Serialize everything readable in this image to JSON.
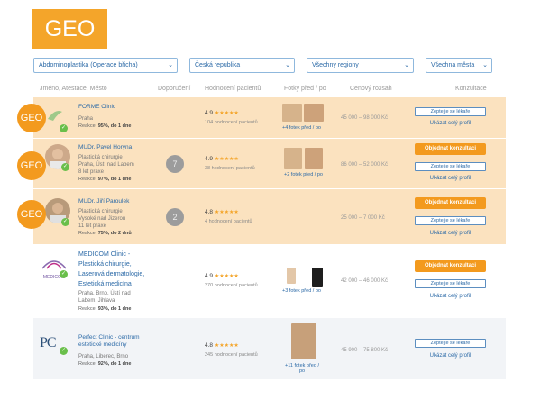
{
  "banner": {
    "label": "GEO"
  },
  "filters": [
    {
      "value": "Abdominoplastika (Operace břicha)"
    },
    {
      "value": "Česká republika"
    },
    {
      "value": "Všechny regiony"
    },
    {
      "value": "Všechna města"
    }
  ],
  "columns": {
    "name": "Jméno, Atestace, Město",
    "recommended": "Doporučení",
    "rating": "Hodnocení pacientů",
    "photos": "Fotky před / po",
    "price": "Cenový rozsah",
    "consult": "Konzultace"
  },
  "badge": "GEO",
  "rows": [
    {
      "name": "FORME Clinic",
      "lines": [
        "Praha"
      ],
      "response_label": "Reakce:",
      "response": "95%, do 1 dne",
      "recommended": "",
      "rating": "4.9",
      "stars": "★★★★★",
      "reviews": "104 hodnocení pacientů",
      "photos": "+4 fotek před / po",
      "price": "45 000 – 98 000 Kč",
      "btn_consult": "",
      "btn_ask": "Zeptejte se lékaře",
      "link": "Ukázat celý profil"
    },
    {
      "name": "MUDr. Pavel Horyna",
      "lines": [
        "Plastická chirurgie",
        "Praha, Ústí nad Labem",
        "8 let praxe"
      ],
      "response_label": "Reakce:",
      "response": "97%, do 1 dne",
      "recommended": "7",
      "rating": "4.9",
      "stars": "★★★★★",
      "reviews": "38 hodnocení pacientů",
      "photos": "+2 fotek před / po",
      "price": "86 000 – 52 000 Kč",
      "btn_consult": "Objednat konzultaci",
      "btn_ask": "Zeptejte se lékaře",
      "link": "Ukázat celý profil"
    },
    {
      "name": "MUDr. Jiří Paroulek",
      "lines": [
        "Plastická chirurgie",
        "Vysoké nad Jizerou",
        "11 let praxe"
      ],
      "response_label": "Reakce:",
      "response": "75%, do 2 dnů",
      "recommended": "2",
      "rating": "4.8",
      "stars": "★★★★★",
      "reviews": "4 hodnocení pacientů",
      "photos": "",
      "price": "25 000 – 7 000 Kč",
      "btn_consult": "Objednat konzultaci",
      "btn_ask": "Zeptejte se lékaře",
      "link": "Ukázat celý profil"
    },
    {
      "name": "MEDICOM Clinic - Plastická chirurgie, Laserová dermatologie, Estetická medicína",
      "lines": [
        "Praha, Brno, Ústí nad Labem, Jihlava"
      ],
      "response_label": "Reakce:",
      "response": "93%, do 1 dne",
      "recommended": "",
      "rating": "4.9",
      "stars": "★★★★★",
      "reviews": "270 hodnocení pacientů",
      "photos": "+3 fotek před / po",
      "price": "42 000 – 46 000 Kč",
      "btn_consult": "Objednat konzultaci",
      "btn_ask": "Zeptejte se lékaře",
      "link": "Ukázat celý profil"
    },
    {
      "name": "Perfect Clinic - centrum estetické medicíny",
      "lines": [
        "Praha, Liberec, Brno"
      ],
      "response_label": "Reakce:",
      "response": "92%, do 1 dne",
      "recommended": "",
      "rating": "4.8",
      "stars": "★★★★★",
      "reviews": "245 hodnocení pacientů",
      "photos": "+11 fotek před / po",
      "price": "45 900 – 75 800 Kč",
      "btn_consult": "",
      "btn_ask": "Zeptejte se lékaře",
      "link": "Ukázat celý profil"
    }
  ],
  "logos": {
    "medicom": "MEDICOM",
    "perfect": "PC"
  }
}
